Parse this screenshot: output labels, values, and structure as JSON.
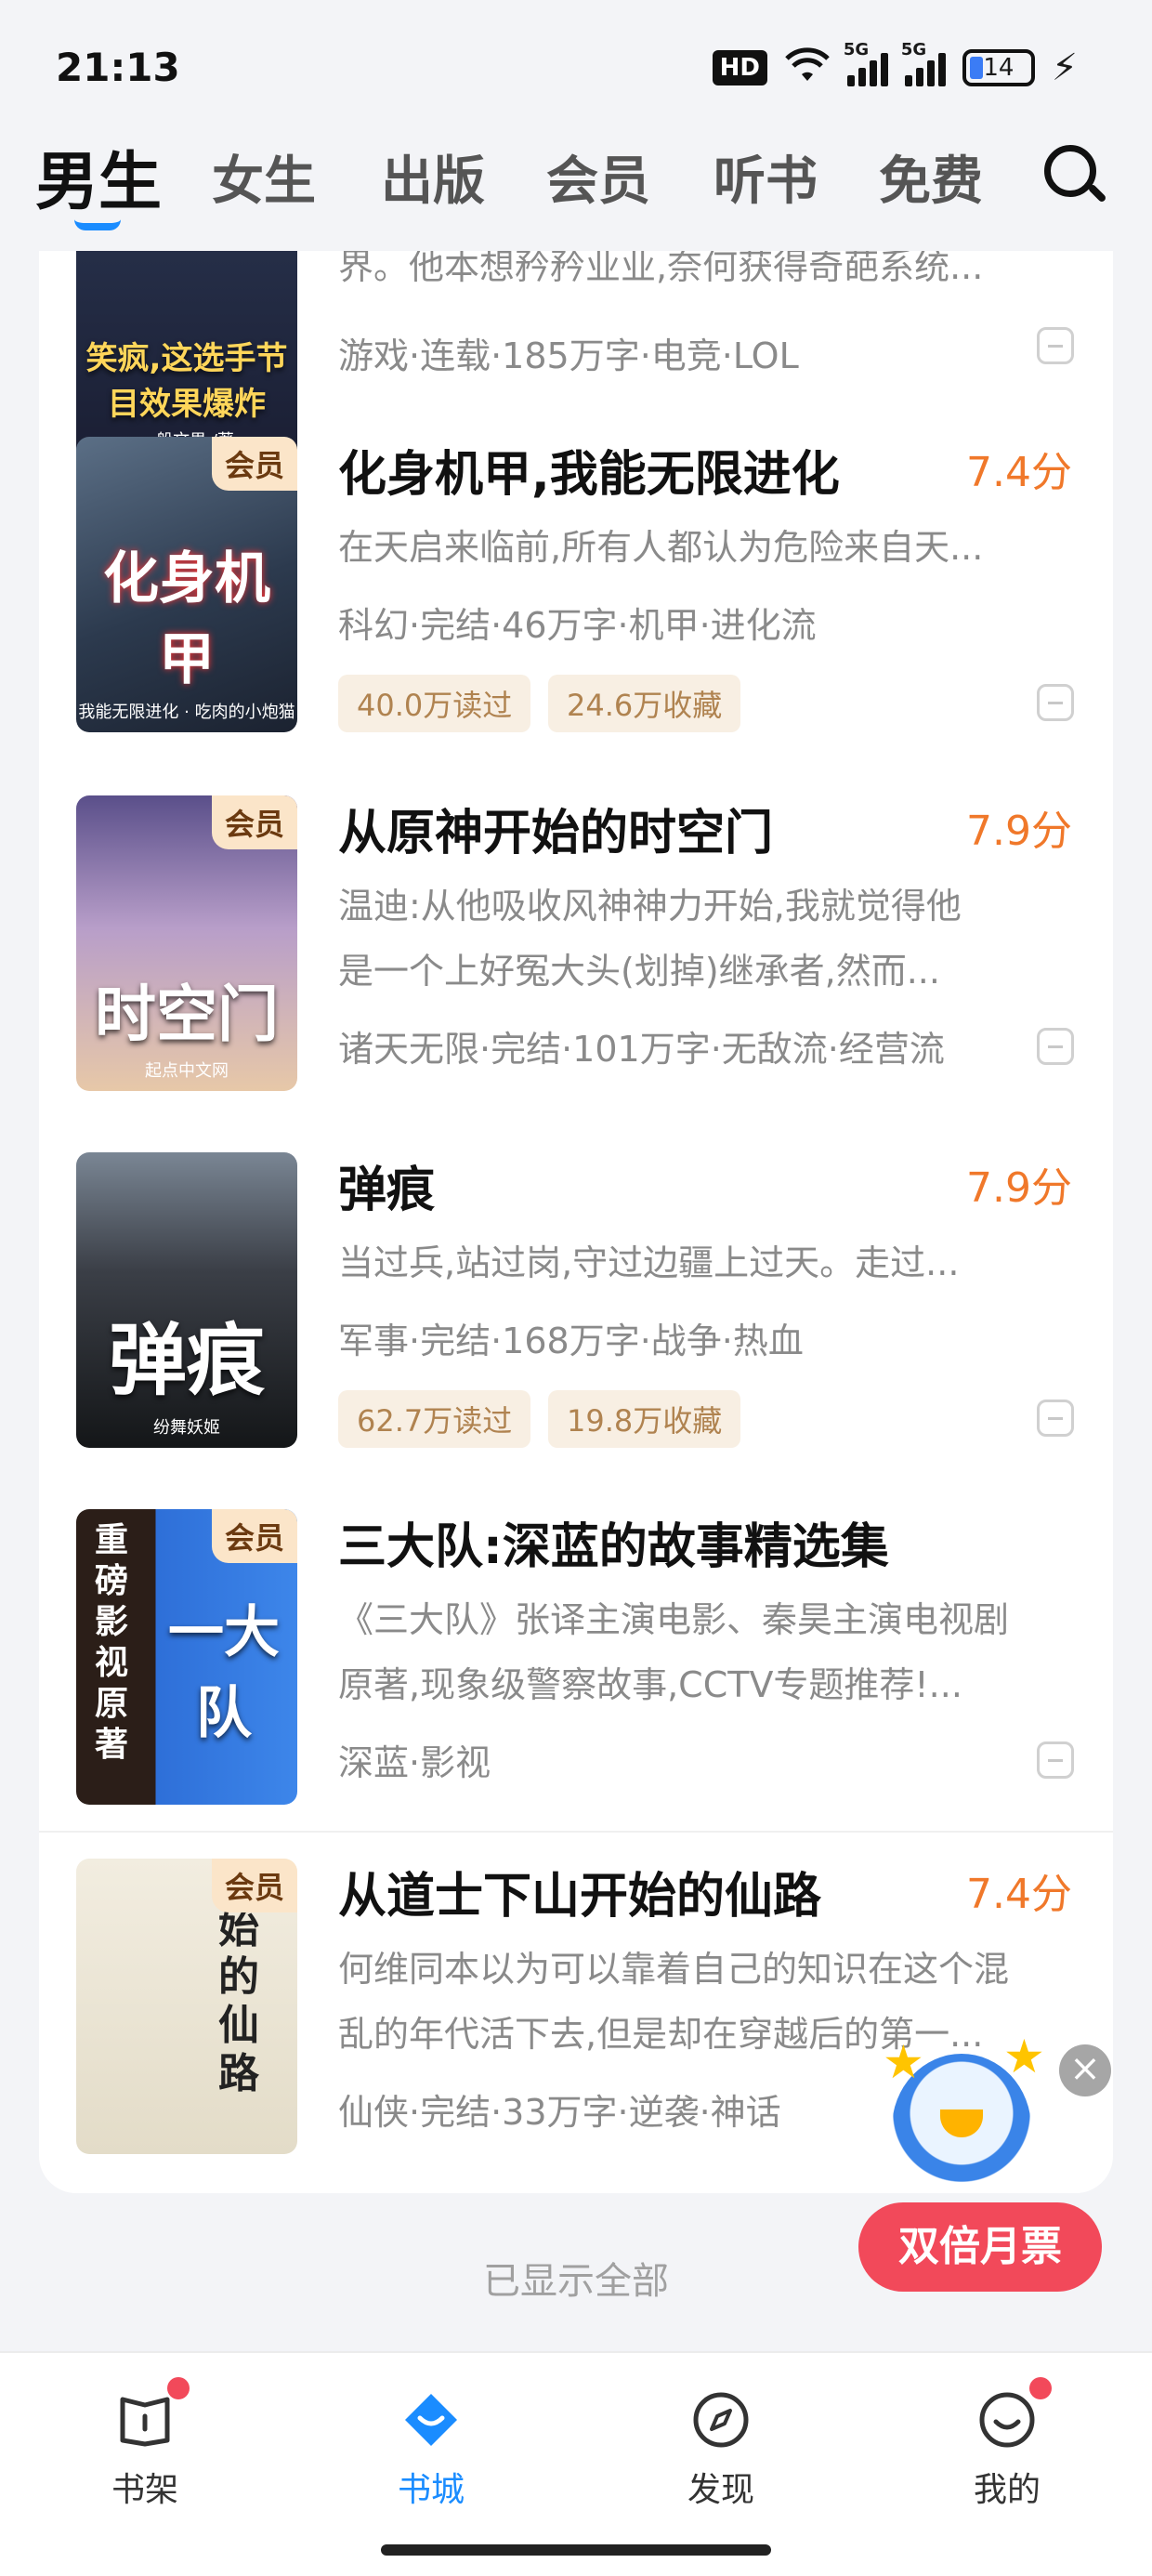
{
  "status_bar": {
    "time": "21:13",
    "hd": "HD",
    "network_1": "5G",
    "network_2": "5G",
    "battery": "14"
  },
  "top_tabs": [
    {
      "label": "男生",
      "active": true
    },
    {
      "label": "女生"
    },
    {
      "label": "出版"
    },
    {
      "label": "会员"
    },
    {
      "label": "听书"
    },
    {
      "label": "免费"
    }
  ],
  "books": [
    {
      "cover_text": "笑疯,这选手节目效果爆炸",
      "cover_sub": "一般文男 /著",
      "desc": "界。他本想矜矜业业,奈何获得奇葩系统...",
      "meta": "游戏·连载·185万字·电竞·LOL"
    },
    {
      "vip": "会员",
      "cover_text": "化身机甲",
      "cover_sub": "我能无限进化 · 吃肉的小炮猫",
      "title": "化身机甲,我能无限进化",
      "score": "7.4分",
      "desc": "在天启来临前,所有人都认为危险来自天...",
      "meta": "科幻·完结·46万字·机甲·进化流",
      "reads": "40.0万读过",
      "favs": "24.6万收藏"
    },
    {
      "vip": "会员",
      "cover_text": "时空门",
      "cover_sub": "起点中文网",
      "title": "从原神开始的时空门",
      "score": "7.9分",
      "desc_1": "温迪:从他吸收风神神力开始,我就觉得他",
      "desc_2": "是一个上好冤大头(划掉)继承者,然而...",
      "meta": "诸天无限·完结·101万字·无敌流·经营流"
    },
    {
      "cover_text": "弹痕",
      "cover_sub": "纷舞妖姬",
      "title": "弹痕",
      "score": "7.9分",
      "desc": "当过兵,站过岗,守过边疆上过天。走过...",
      "meta": "军事·完结·168万字·战争·热血",
      "reads": "62.7万读过",
      "favs": "19.8万收藏"
    },
    {
      "vip": "会员",
      "cover_text": "一大队",
      "cover_side": "重磅影视原著",
      "title": "三大队:深蓝的故事精选集",
      "desc_1": "《三大队》张译主演电影、秦昊主演电视剧",
      "desc_2": "原著,现象级警察故事,CCTV专题推荐!...",
      "meta": "深蓝·影视"
    },
    {
      "vip": "会员",
      "cover_text": "始的仙路",
      "title": "从道士下山开始的仙路",
      "score": "7.4分",
      "desc_1": "何维同本以为可以靠着自己的知识在这个混",
      "desc_2": "乱的年代活下去,但是却在穿越后的第一...",
      "meta": "仙侠·完结·33万字·逆袭·神话"
    }
  ],
  "end_text": "已显示全部",
  "promo": {
    "button": "双倍月票",
    "close": "×"
  },
  "bottom_nav": [
    {
      "label": "书架",
      "icon": "bookshelf-icon",
      "dot": true
    },
    {
      "label": "书城",
      "icon": "bookstore-icon",
      "active": true
    },
    {
      "label": "发现",
      "icon": "compass-icon"
    },
    {
      "label": "我的",
      "icon": "profile-icon",
      "dot": true
    }
  ],
  "colors": {
    "accent": "#1a8cff",
    "score": "#f0782a",
    "promo": "#f2495a",
    "vip_bg": "#fbe5c9"
  }
}
